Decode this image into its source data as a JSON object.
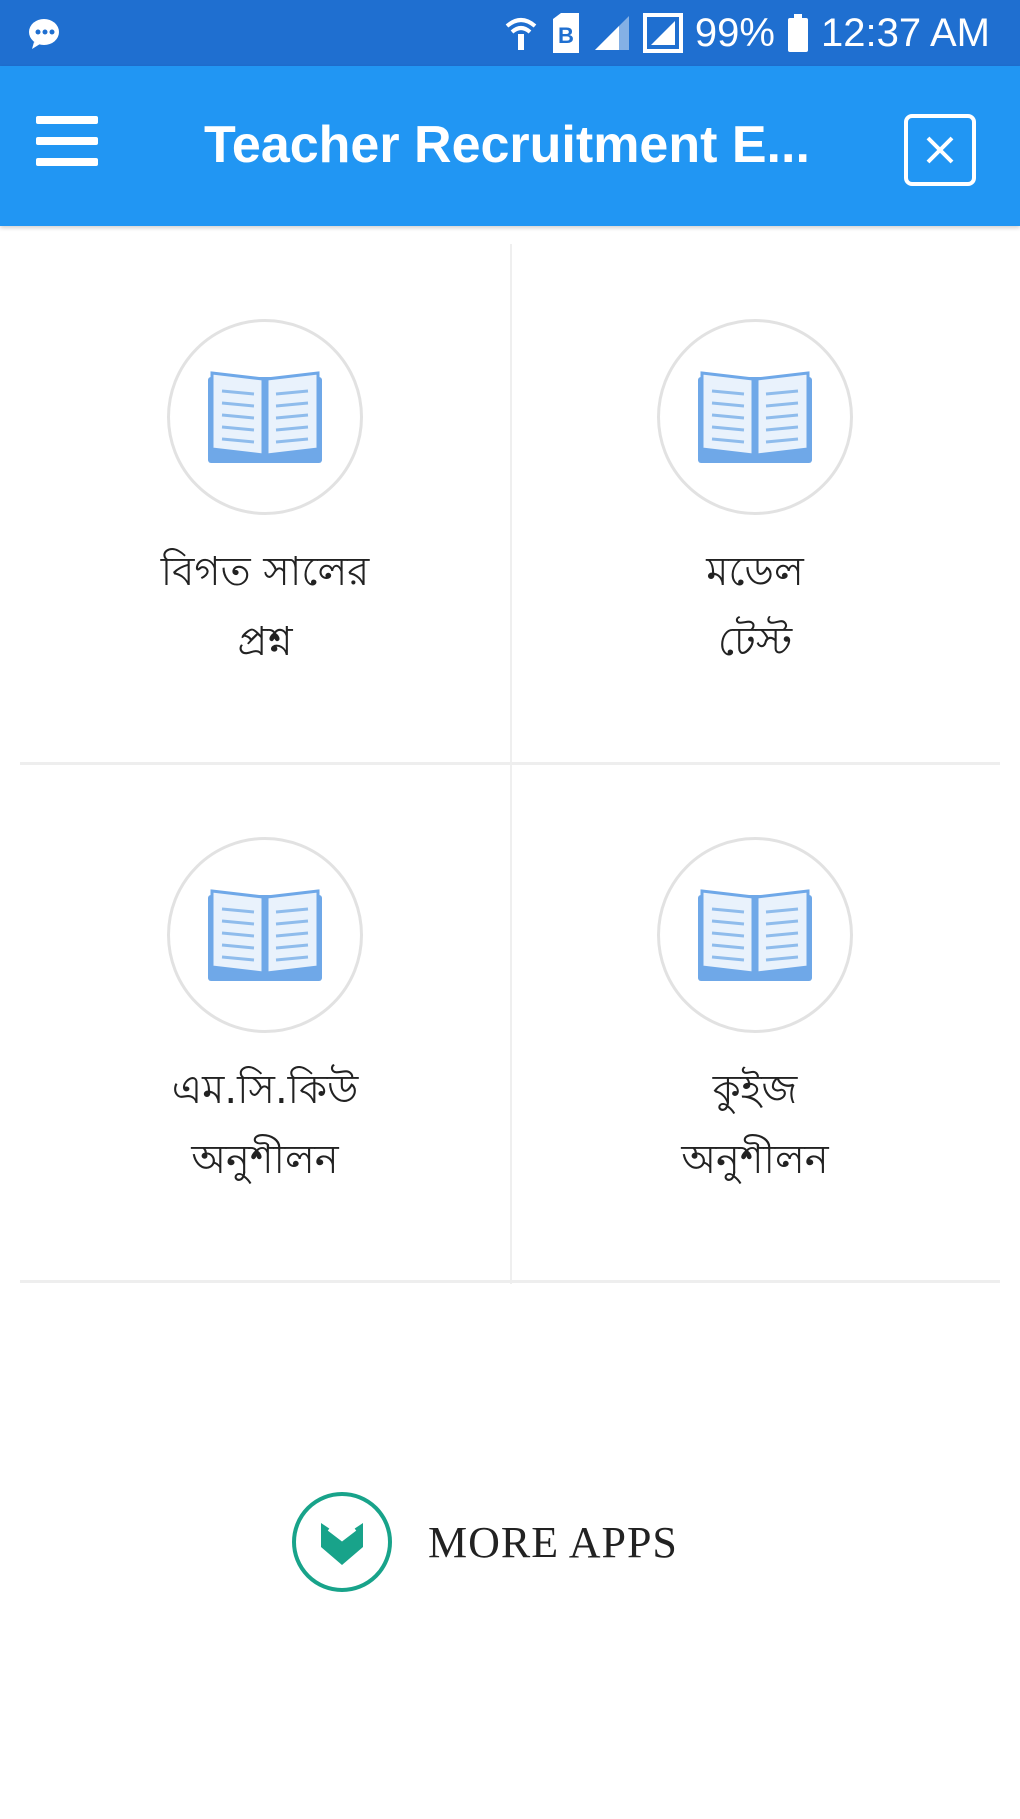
{
  "status_bar": {
    "battery_text": "99%",
    "time": "12:37 AM",
    "icons": [
      "notification-icon",
      "wifi-icon",
      "sim-icon",
      "signal-icon",
      "data-icon",
      "battery-icon"
    ]
  },
  "app_bar": {
    "title": "Teacher Recruitment E...",
    "menu_icon": "hamburger-icon",
    "close_icon": "close-box-icon"
  },
  "tiles": [
    {
      "line1": "বিগত সালের",
      "line2": "প্রশ্ন",
      "icon": "book-icon"
    },
    {
      "line1": "মডেল",
      "line2": "টেস্ট",
      "icon": "book-icon"
    },
    {
      "line1": "এম.সি.কিউ",
      "line2": "অনুশীলন",
      "icon": "book-icon"
    },
    {
      "line1": "কুইজ",
      "line2": "অনুশীলন",
      "icon": "book-icon"
    }
  ],
  "more_apps": {
    "label": "MORE APPS",
    "icon": "more-apps-logo-icon"
  },
  "colors": {
    "status_bar": "#1f6fd0",
    "app_bar": "#2196f3",
    "book_blue": "#7fb3ea",
    "logo_green": "#18a38a"
  }
}
